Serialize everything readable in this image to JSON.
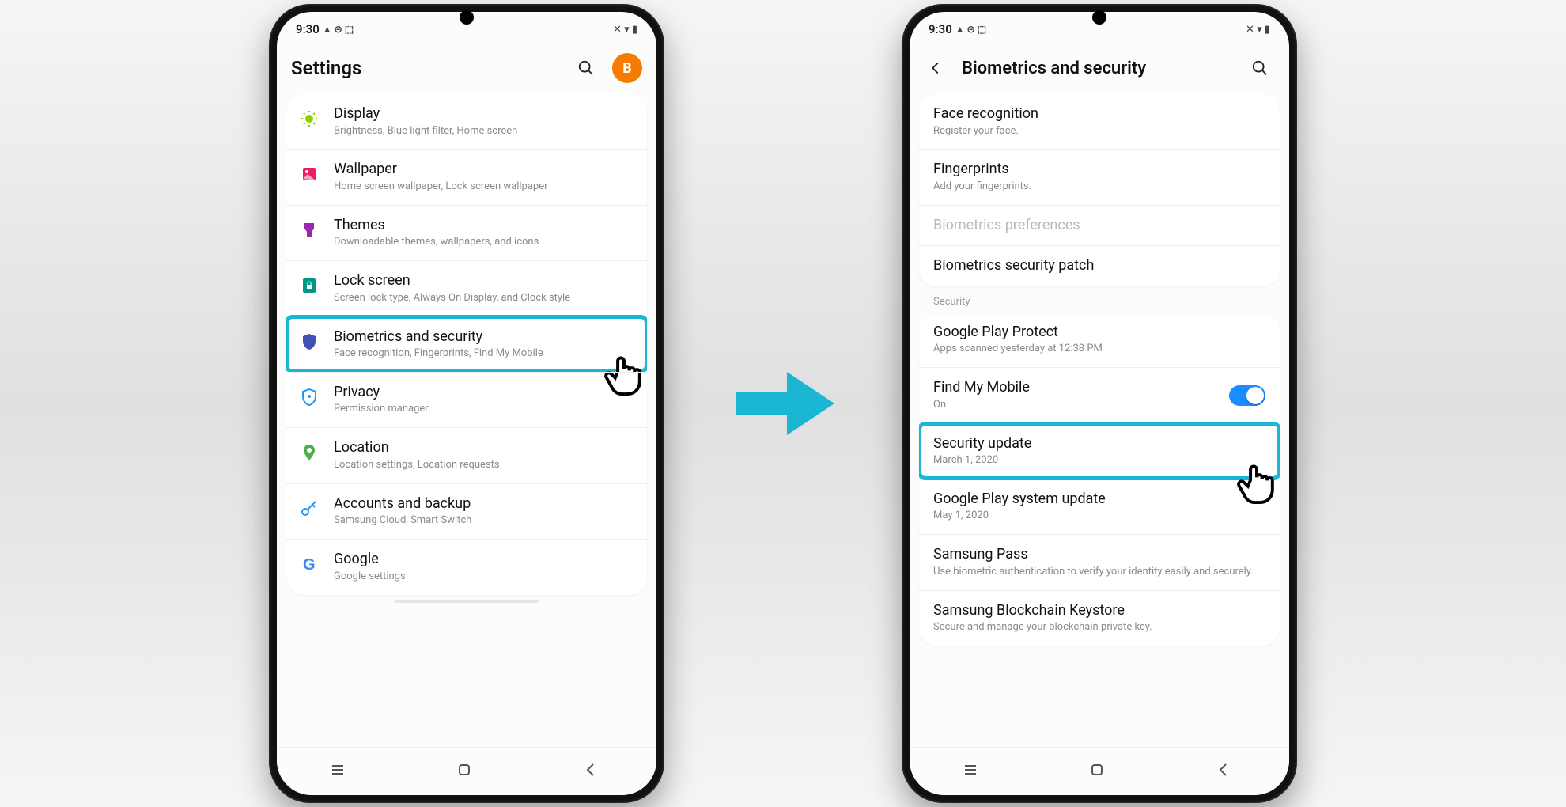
{
  "statusbar": {
    "time": "9:30"
  },
  "phone1": {
    "header": {
      "title": "Settings",
      "avatar": "B"
    },
    "items": [
      {
        "icon": "display",
        "title": "Display",
        "sub": "Brightness, Blue light filter, Home screen"
      },
      {
        "icon": "wallpaper",
        "title": "Wallpaper",
        "sub": "Home screen wallpaper, Lock screen wallpaper"
      },
      {
        "icon": "themes",
        "title": "Themes",
        "sub": "Downloadable themes, wallpapers, and icons"
      },
      {
        "icon": "lock",
        "title": "Lock screen",
        "sub": "Screen lock type, Always On Display, and Clock style"
      },
      {
        "icon": "shield",
        "title": "Biometrics and security",
        "sub": "Face recognition, Fingerprints, Find My Mobile",
        "highlight": true
      },
      {
        "icon": "privacy",
        "title": "Privacy",
        "sub": "Permission manager"
      },
      {
        "icon": "location",
        "title": "Location",
        "sub": "Location settings, Location requests"
      },
      {
        "icon": "key",
        "title": "Accounts and backup",
        "sub": "Samsung Cloud, Smart Switch"
      },
      {
        "icon": "google",
        "title": "Google",
        "sub": "Google settings"
      }
    ]
  },
  "phone2": {
    "header": {
      "title": "Biometrics and security"
    },
    "group1": [
      {
        "title": "Face recognition",
        "sub": "Register your face."
      },
      {
        "title": "Fingerprints",
        "sub": "Add your fingerprints."
      },
      {
        "title": "Biometrics preferences",
        "disabled": true
      },
      {
        "title": "Biometrics security patch"
      }
    ],
    "section": "Security",
    "group2": [
      {
        "title": "Google Play Protect",
        "sub": "Apps scanned yesterday at 12:38 PM"
      },
      {
        "title": "Find My Mobile",
        "sub": "On",
        "toggle": true
      },
      {
        "title": "Security update",
        "sub": "March 1, 2020",
        "highlight": true
      },
      {
        "title": "Google Play system update",
        "sub": "May 1, 2020"
      },
      {
        "title": "Samsung Pass",
        "sub": "Use biometric authentication to verify your identity easily and securely."
      },
      {
        "title": "Samsung Blockchain Keystore",
        "sub": "Secure and manage your blockchain private key."
      }
    ]
  }
}
